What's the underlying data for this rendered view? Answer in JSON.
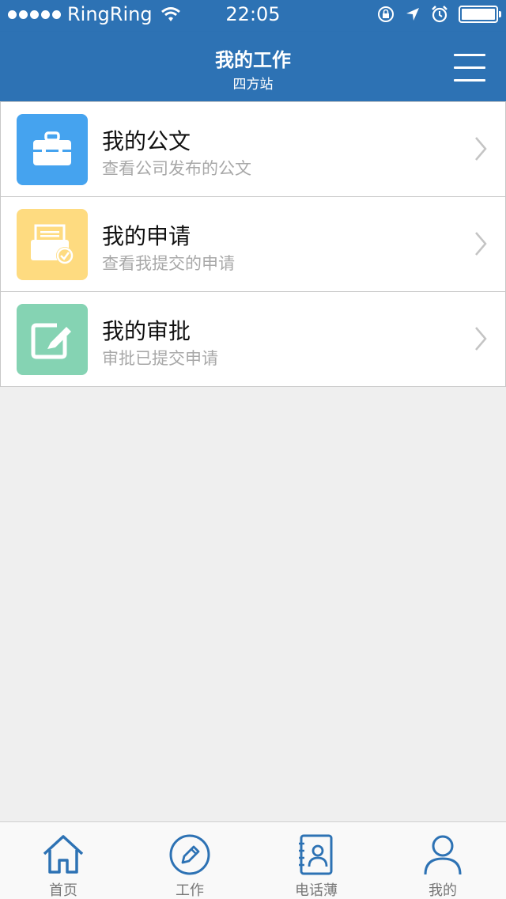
{
  "status_bar": {
    "carrier": "RingRing",
    "time": "22:05",
    "icons": [
      "signal-dots-icon",
      "wifi-icon",
      "rotation-lock-icon",
      "location-arrow-icon",
      "alarm-icon",
      "battery-icon"
    ]
  },
  "header": {
    "title": "我的工作",
    "subtitle": "四方站",
    "menu_icon": "hamburger-menu-icon",
    "background": "#2d72b4"
  },
  "items": [
    {
      "title": "我的公文",
      "subtitle": "查看公司发布的公文",
      "icon": "briefcase-icon",
      "color": "#45a3ef"
    },
    {
      "title": "我的申请",
      "subtitle": "查看我提交的申请",
      "icon": "document-check-icon",
      "color": "#fedb80"
    },
    {
      "title": "我的审批",
      "subtitle": "审批已提交申请",
      "icon": "edit-pen-icon",
      "color": "#85d3b3"
    }
  ],
  "tabbar": {
    "accent": "#2d72b4",
    "tabs": [
      {
        "label": "首页",
        "icon": "home-icon"
      },
      {
        "label": "工作",
        "icon": "pencil-circle-icon"
      },
      {
        "label": "电话薄",
        "icon": "contacts-book-icon"
      },
      {
        "label": "我的",
        "icon": "person-icon"
      }
    ]
  }
}
